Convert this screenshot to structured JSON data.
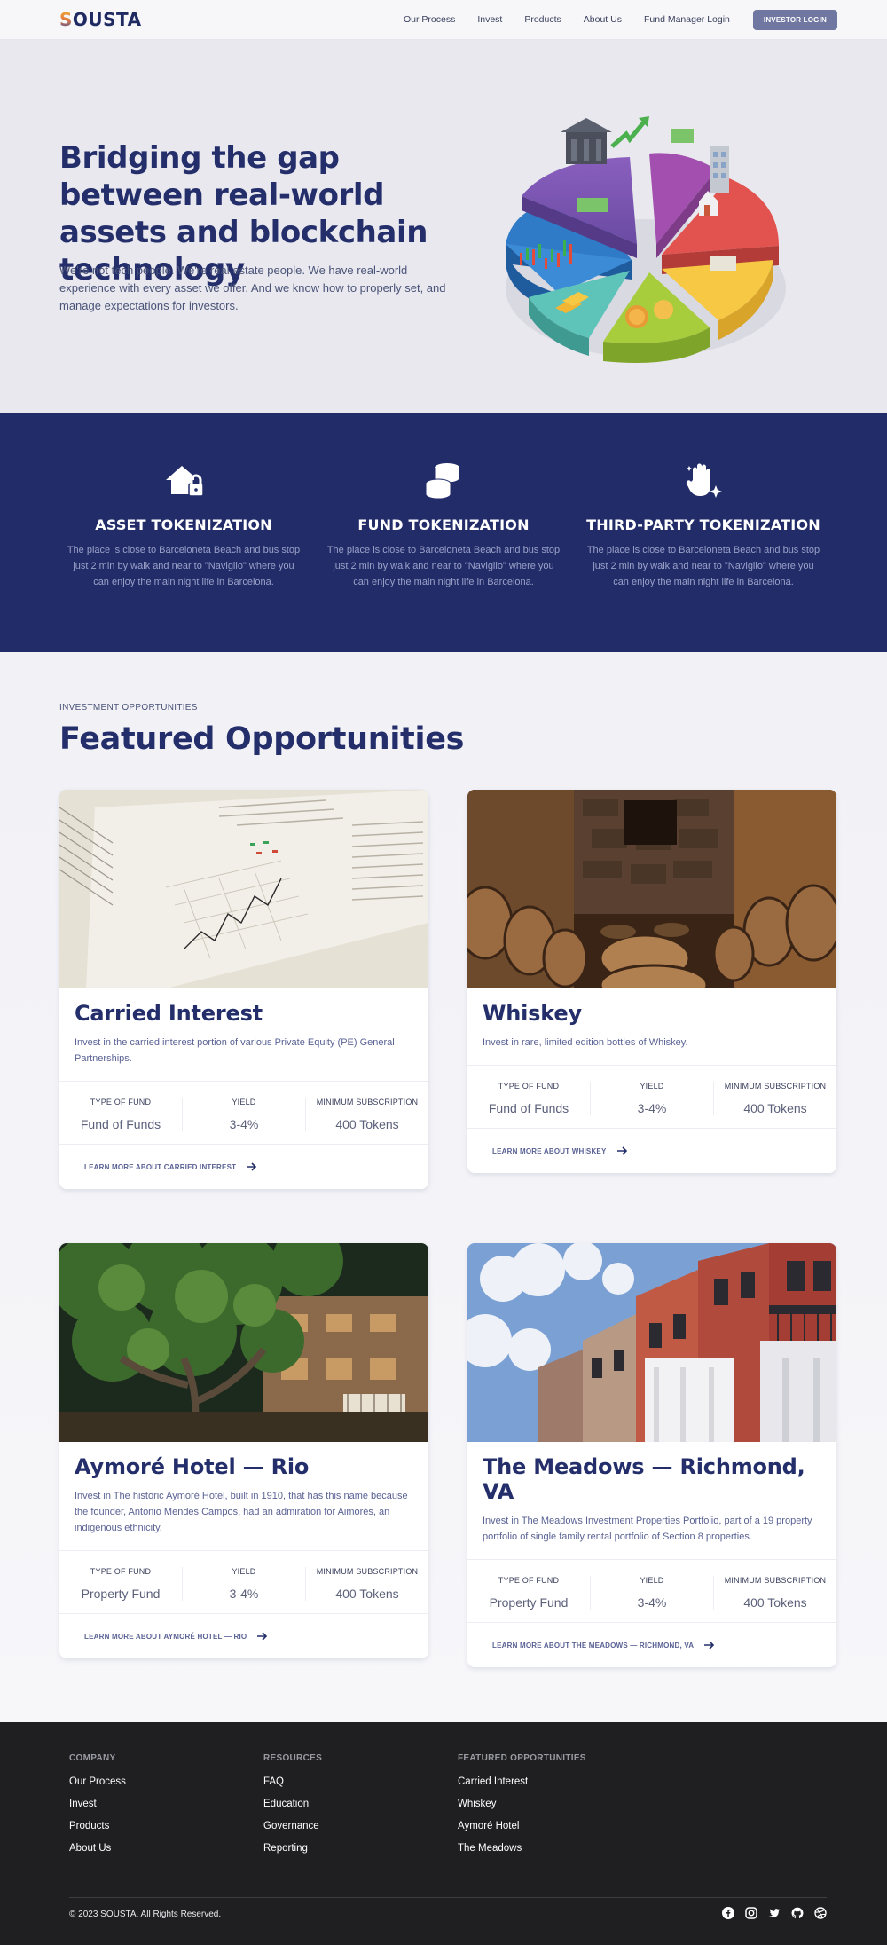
{
  "nav": {
    "logo_first": "S",
    "logo_rest": "OUSTA",
    "links": [
      "Our Process",
      "Invest",
      "Products",
      "About Us",
      "Fund Manager Login"
    ],
    "cta": "INVESTOR LOGIN"
  },
  "hero": {
    "title": "Bridging the gap between real-world assets and blockchain technology",
    "subtitle": "We're not tech people. We're real estate people. We have real-world experience with every asset we offer. And we know how to properly set, and manage expectations for investors."
  },
  "services": [
    {
      "icon": "house-lock-icon",
      "title": "ASSET TOKENIZATION",
      "text": "The place is close to Barceloneta Beach and bus stop just 2 min by walk and near to \"Naviglio\" where you can enjoy the main night life in Barcelona."
    },
    {
      "icon": "coins-stack-icon",
      "title": "FUND TOKENIZATION",
      "text": "The place is close to Barceloneta Beach and bus stop just 2 min by walk and near to \"Naviglio\" where you can enjoy the main night life in Barcelona."
    },
    {
      "icon": "hand-sparkle-icon",
      "title": "THIRD-PARTY TOKENIZATION",
      "text": "The place is close to Barceloneta Beach and bus stop just 2 min by walk and near to \"Naviglio\" where you can enjoy the main night life in Barcelona."
    }
  ],
  "opportunities": {
    "eyebrow": "INVESTMENT OPPORTUNITIES",
    "title": "Featured Opportunities",
    "stat_labels": [
      "TYPE OF FUND",
      "YIELD",
      "MINIMUM SUBSCRIPTION"
    ],
    "cards": [
      {
        "title": "Carried Interest",
        "desc": "Invest in the carried interest portion of various Private Equity (PE) General Partnerships.",
        "fund_type": "Fund of Funds",
        "yield": "3-4%",
        "min": "400 Tokens",
        "link": "LEARN MORE ABOUT CARRIED INTEREST"
      },
      {
        "title": "Whiskey",
        "desc": "Invest in rare, limited edition bottles of Whiskey.",
        "fund_type": "Fund of Funds",
        "yield": "3-4%",
        "min": "400 Tokens",
        "link": "LEARN MORE ABOUT WHISKEY"
      },
      {
        "title": "Aymoré Hotel — Rio",
        "desc": "Invest in The historic Aymoré Hotel, built in 1910, that has this name because the founder, Antonio Mendes Campos, had an admiration for Aimorés, an indigenous ethnicity.",
        "fund_type": "Property Fund",
        "yield": "3-4%",
        "min": "400 Tokens",
        "link": "LEARN MORE ABOUT AYMORÉ HOTEL — RIO"
      },
      {
        "title": "The Meadows — Richmond, VA",
        "desc": "Invest in The Meadows Investment Properties Portfolio, part of a 19 property portfolio of single family rental portfolio of Section 8 properties.",
        "fund_type": "Property Fund",
        "yield": "3-4%",
        "min": "400 Tokens",
        "link": "LEARN MORE ABOUT THE MEADOWS — RICHMOND, VA"
      }
    ]
  },
  "footer": {
    "company": {
      "heading": "COMPANY",
      "links": [
        "Our Process",
        "Invest",
        "Products",
        "About Us"
      ]
    },
    "resources": {
      "heading": "RESOURCES",
      "links": [
        "FAQ",
        "Education",
        "Governance",
        "Reporting"
      ]
    },
    "featured": {
      "heading": "FEATURED OPPORTUNITIES",
      "links": [
        "Carried Interest",
        "Whiskey",
        "Aymoré Hotel",
        "The Meadows"
      ]
    },
    "copyright": "© 2023 SOUSTA. All Rights Reserved.",
    "social": [
      "facebook-icon",
      "instagram-icon",
      "twitter-icon",
      "github-icon",
      "dribbble-icon"
    ]
  },
  "colors": {
    "navy": "#222c69",
    "accent_button": "#7077a1",
    "footer_bg": "#1f1f21"
  }
}
